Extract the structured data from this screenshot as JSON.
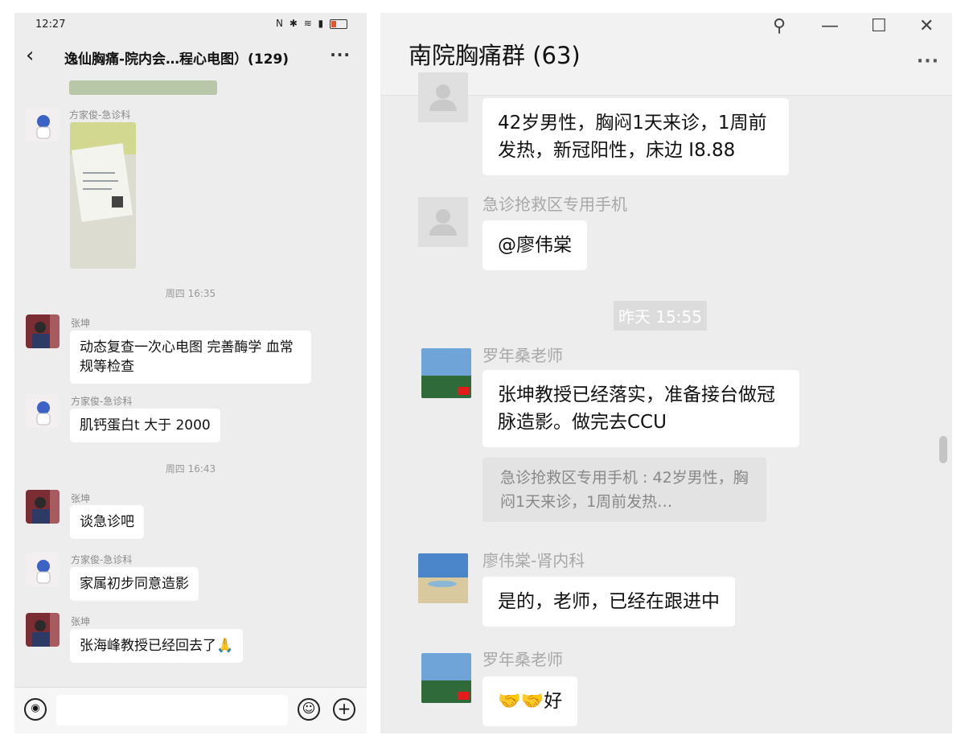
{
  "left": {
    "status": {
      "time": "12:27",
      "icons_text": "N ✱ ≋ ▮"
    },
    "header": {
      "title": "逸仙胸痛-院内会…程心电图）(129)",
      "back": "‹",
      "more": "···"
    },
    "messages": [
      {
        "sender": "方家俊-急诊科"
      },
      {
        "time": "周四 16:35"
      },
      {
        "sender": "张坤",
        "text": "动态复查一次心电图 完善酶学 血常规等检查"
      },
      {
        "sender": "方家俊-急诊科",
        "text": "肌钙蛋白t 大于 2000"
      },
      {
        "time": "周四 16:43"
      },
      {
        "sender": "张坤",
        "text": "谈急诊吧"
      },
      {
        "sender": "方家俊-急诊科",
        "text": "家属初步同意造影"
      },
      {
        "sender": "张坤",
        "text": "张海峰教授已经回去了🙏"
      }
    ],
    "input": {
      "voice_icon": "◉",
      "emoji_icon": "☺",
      "plus_icon": "+"
    }
  },
  "right": {
    "header": {
      "title": "南院胸痛群 (63)",
      "pin_icon": "⚲",
      "min_icon": "—",
      "max_icon": "☐",
      "close_icon": "✕",
      "more": "···"
    },
    "messages": [
      {
        "text": "42岁男性，胸闷1天来诊，1周前发热，新冠阳性，床边 I8.88"
      },
      {
        "sender": "急诊抢救区专用手机",
        "text": "@廖伟棠"
      },
      {
        "time": "昨天 15:55"
      },
      {
        "sender": "罗年桑老师",
        "text": "张坤教授已经落实，准备接台做冠脉造影。做完去CCU",
        "quote": "急诊抢救区专用手机 : 42岁男性，胸闷1天来诊，1周前发热…"
      },
      {
        "sender": "廖伟棠-肾内科",
        "text": "是的，老师，已经在跟进中"
      },
      {
        "sender": "罗年桑老师",
        "text": "🤝🤝好"
      }
    ]
  }
}
